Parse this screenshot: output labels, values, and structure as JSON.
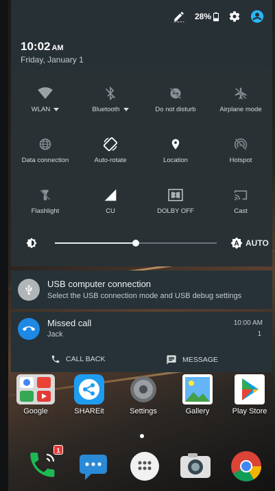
{
  "status_bar": {
    "battery": "28%"
  },
  "header": {
    "time": "10:02",
    "ampm": "AM",
    "date": "Friday, January 1"
  },
  "quick_settings": [
    {
      "label": "WLAN",
      "icon": "wifi-icon",
      "dropdown": true
    },
    {
      "label": "Bluetooth",
      "icon": "bluetooth-off-icon",
      "dropdown": true
    },
    {
      "label": "Do not disturb",
      "icon": "do-not-disturb-off-icon"
    },
    {
      "label": "Airplane mode",
      "icon": "airplane-off-icon"
    },
    {
      "label": "Data connection",
      "icon": "globe-icon"
    },
    {
      "label": "Auto-rotate",
      "icon": "auto-rotate-icon"
    },
    {
      "label": "Location",
      "icon": "location-icon"
    },
    {
      "label": "Hotspot",
      "icon": "hotspot-off-icon"
    },
    {
      "label": "Flashlight",
      "icon": "flashlight-off-icon"
    },
    {
      "label": "CU",
      "icon": "signal-icon"
    },
    {
      "label": "DOLBY OFF",
      "icon": "dolby-icon"
    },
    {
      "label": "Cast",
      "icon": "cast-icon"
    }
  ],
  "brightness": {
    "level": 0.5,
    "auto_label": "AUTO"
  },
  "notifications": {
    "usb": {
      "title": "USB computer connection",
      "text": "Select the USB connection mode and USB debug settings"
    },
    "missed_call": {
      "title": "Missed call",
      "caller": "Jack",
      "time": "10:00 AM",
      "count": "1",
      "call_back_label": "CALL BACK",
      "message_label": "MESSAGE"
    }
  },
  "home_apps": [
    {
      "label": "Google"
    },
    {
      "label": "SHAREit"
    },
    {
      "label": "Settings"
    },
    {
      "label": "Gallery"
    },
    {
      "label": "Play Store"
    }
  ],
  "dock": {
    "phone_badge": "1"
  },
  "colors": {
    "accent": "#29b6f6",
    "shade": "#293135",
    "missed_call_blue": "#1e88e5"
  }
}
